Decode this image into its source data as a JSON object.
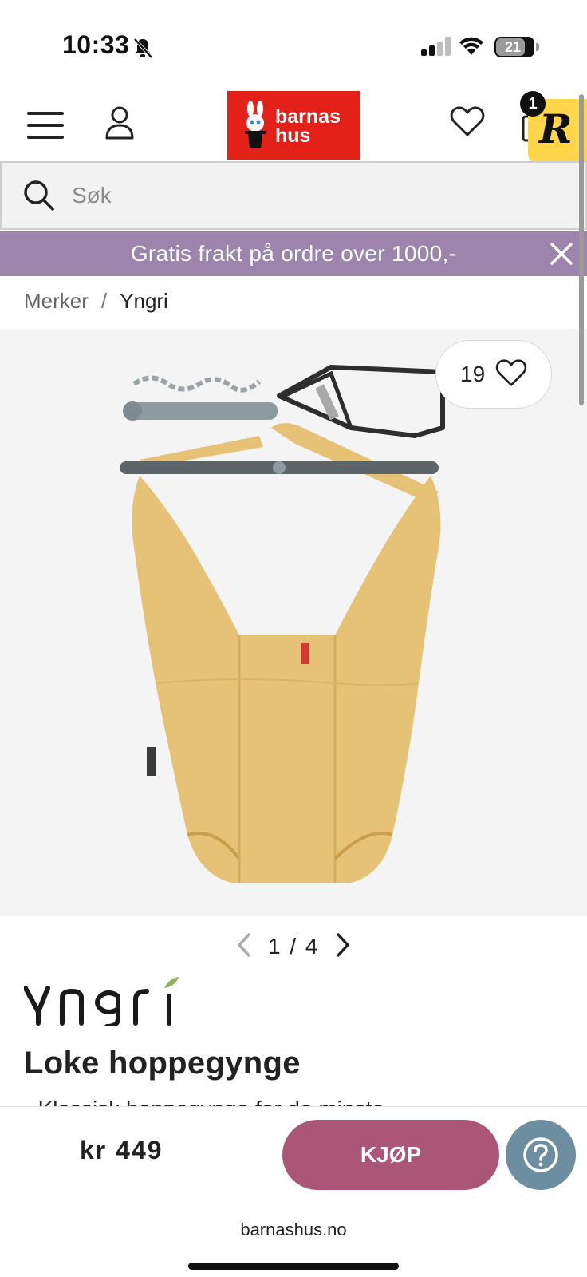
{
  "status_bar": {
    "time": "10:33",
    "battery": "21"
  },
  "header": {
    "logo_text_line1": "barnas",
    "logo_text_line2": "hus",
    "cart_count": "1"
  },
  "search": {
    "placeholder": "Søk"
  },
  "promo": {
    "text": "Gratis frakt på ordre over 1000,-"
  },
  "breadcrumb": {
    "items": [
      "Merker",
      "Yngri"
    ],
    "separator": "/"
  },
  "product": {
    "favorites_count": "19",
    "pager": "1 / 4",
    "brand": "Yngri",
    "title": "Loke hoppegynge",
    "description": "• Klassisk hoppegynge for de minste",
    "price": "kr 449",
    "buy_label": "KJØP"
  },
  "browser": {
    "url": "barnashus.no"
  },
  "colors": {
    "brand_red": "#e32119",
    "promo_purple": "#9c84ad",
    "buy_button": "#ab5676",
    "help_button": "#6d8ea0",
    "product_fabric": "#e6c277"
  }
}
